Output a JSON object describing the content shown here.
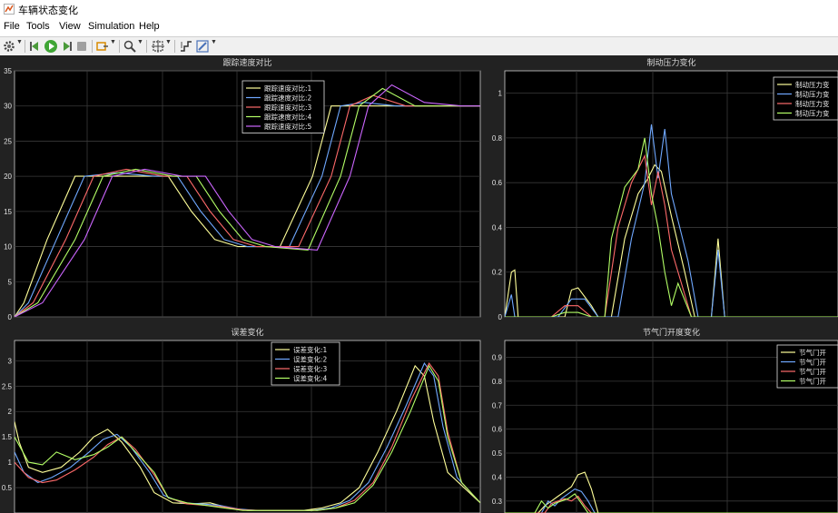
{
  "window": {
    "title": "车辆状态变化"
  },
  "menu": [
    "File",
    "Tools",
    "View",
    "Simulation",
    "Help"
  ],
  "toolbar": {
    "icons": [
      "settings-icon",
      "step-back-icon",
      "run-icon",
      "step-forward-icon",
      "stop-icon",
      "highlight-icon",
      "zoom-icon",
      "fit-icon",
      "cursor-measure-icon",
      "style-icon"
    ]
  },
  "colors": {
    "plot_bg": "#000000",
    "figure_bg": "#222222",
    "grid": "#3a3a3a",
    "axis_text": "#e0e0e0"
  },
  "chart_data": [
    {
      "type": "line",
      "title": "跟踪速度对比",
      "ylim": [
        0,
        35
      ],
      "yticks": [
        "0",
        "5",
        "10",
        "15",
        "20",
        "25",
        "30",
        "35"
      ],
      "xticks": [],
      "legend_position": "top-center",
      "series": [
        {
          "name": "跟踪速度对比:1",
          "color": "#ffff99",
          "x": [
            0,
            2,
            7,
            13,
            20,
            28,
            33,
            38,
            43,
            48,
            57,
            64,
            68,
            73,
            80,
            90,
            100
          ],
          "y": [
            0,
            2,
            11,
            20,
            20,
            20,
            20,
            15,
            11,
            10,
            10,
            20,
            30,
            30,
            30,
            30,
            30
          ]
        },
        {
          "name": "跟踪速度对比:2",
          "color": "#6fa8ff",
          "x": [
            0,
            3,
            9,
            15,
            22,
            30,
            35,
            40,
            45,
            50,
            59,
            66,
            70,
            75,
            82,
            90,
            100
          ],
          "y": [
            0,
            2,
            11,
            20,
            20.5,
            20,
            20,
            15,
            11,
            10,
            10,
            20,
            30,
            30.5,
            30,
            30,
            30
          ]
        },
        {
          "name": "跟踪速度对比:3",
          "color": "#ff6a6a",
          "x": [
            0,
            4,
            11,
            17,
            24,
            32,
            37,
            42,
            47,
            52,
            61,
            68,
            72,
            77,
            84,
            92,
            100
          ],
          "y": [
            0,
            2,
            11,
            20,
            21,
            20,
            20,
            15,
            11,
            10,
            10,
            20,
            30,
            31.5,
            30,
            30,
            30
          ]
        },
        {
          "name": "跟踪速度对比:4",
          "color": "#b3ff66",
          "x": [
            0,
            5,
            13,
            19,
            26,
            34,
            39,
            44,
            49,
            54,
            63,
            70,
            74,
            79,
            86,
            94,
            100
          ],
          "y": [
            0,
            2,
            11,
            20,
            21,
            20,
            20,
            15,
            11,
            10,
            9.5,
            20,
            30,
            32.5,
            30,
            30,
            30
          ]
        },
        {
          "name": "跟踪速度对比:5",
          "color": "#cc66ff",
          "x": [
            0,
            6,
            15,
            21,
            28,
            36,
            41,
            46,
            51,
            56,
            65,
            72,
            76,
            81,
            88,
            96,
            100
          ],
          "y": [
            0,
            2,
            11,
            20,
            21,
            20,
            20,
            15,
            11,
            10,
            9.5,
            20,
            30,
            33,
            30.5,
            30,
            30
          ]
        }
      ]
    },
    {
      "type": "line",
      "title": "制动压力变化",
      "ylim": [
        0,
        1.1
      ],
      "yticks": [
        "0",
        "0.2",
        "0.4",
        "0.6",
        "0.8",
        "1"
      ],
      "xticks": [],
      "legend_position": "top-right",
      "series": [
        {
          "name": "制动压力变",
          "color": "#ffff99",
          "x": [
            0,
            2,
            3,
            4,
            18,
            20,
            22,
            26,
            28,
            32,
            36,
            40,
            43,
            45,
            47,
            50,
            54,
            57,
            62,
            64,
            66,
            70,
            72,
            74,
            100
          ],
          "y": [
            0,
            0.2,
            0.21,
            0,
            0,
            0.12,
            0.13,
            0.05,
            0,
            0,
            0.35,
            0.55,
            0.62,
            0.68,
            0.65,
            0.45,
            0.2,
            0,
            0,
            0.35,
            0,
            0,
            0,
            0,
            0
          ]
        },
        {
          "name": "制动压力变",
          "color": "#6fa8ff",
          "x": [
            0,
            2,
            3,
            16,
            20,
            24,
            28,
            34,
            38,
            42,
            44,
            46,
            48,
            50,
            55,
            58,
            62,
            64,
            66,
            70,
            100
          ],
          "y": [
            0,
            0.1,
            0,
            0,
            0.08,
            0.08,
            0,
            0,
            0.35,
            0.6,
            0.86,
            0.62,
            0.84,
            0.55,
            0.25,
            0,
            0,
            0.3,
            0,
            0,
            0
          ]
        },
        {
          "name": "制动压力变",
          "color": "#ff6a6a",
          "x": [
            0,
            14,
            18,
            22,
            26,
            30,
            34,
            38,
            42,
            44,
            46,
            48,
            50,
            53,
            56,
            60,
            100
          ],
          "y": [
            0,
            0,
            0.05,
            0.05,
            0,
            0,
            0.4,
            0.6,
            0.72,
            0.5,
            0.65,
            0.5,
            0.3,
            0.15,
            0,
            0,
            0
          ]
        },
        {
          "name": "制动压力变",
          "color": "#b3ff66",
          "x": [
            0,
            14,
            18,
            22,
            26,
            30,
            32,
            36,
            40,
            42,
            44,
            46,
            48,
            50,
            52,
            56,
            100
          ],
          "y": [
            0,
            0,
            0.02,
            0.02,
            0,
            0,
            0.35,
            0.58,
            0.66,
            0.8,
            0.55,
            0.4,
            0.2,
            0.05,
            0.15,
            0,
            0
          ]
        }
      ]
    },
    {
      "type": "line",
      "title": "误差变化",
      "ylim": [
        0,
        3.4
      ],
      "yticks": [
        "0.5",
        "1",
        "1.5",
        "2",
        "2.5",
        "3"
      ],
      "xticks": [],
      "legend_position": "top-center",
      "series": [
        {
          "name": "误差变化:1",
          "color": "#ffff99",
          "x": [
            0,
            1,
            3,
            6,
            10,
            14,
            17,
            20,
            23,
            27,
            30,
            34,
            38,
            42,
            46,
            50,
            54,
            58,
            62,
            66,
            70,
            74,
            78,
            82,
            86,
            88,
            90,
            93,
            100
          ],
          "y": [
            1.8,
            1.4,
            0.9,
            0.8,
            0.9,
            1.2,
            1.5,
            1.65,
            1.4,
            0.9,
            0.4,
            0.2,
            0.18,
            0.2,
            0.1,
            0.05,
            0.05,
            0.05,
            0.05,
            0.1,
            0.2,
            0.5,
            1.2,
            2.0,
            2.9,
            2.7,
            1.8,
            0.8,
            0.2
          ]
        },
        {
          "name": "误差变化:2",
          "color": "#6fa8ff",
          "x": [
            0,
            2,
            5,
            8,
            12,
            16,
            19,
            22,
            25,
            29,
            32,
            36,
            40,
            44,
            48,
            52,
            56,
            60,
            64,
            68,
            72,
            76,
            80,
            84,
            88,
            90,
            92,
            95,
            100
          ],
          "y": [
            1.2,
            0.8,
            0.6,
            0.7,
            0.9,
            1.2,
            1.45,
            1.55,
            1.3,
            0.8,
            0.35,
            0.2,
            0.18,
            0.15,
            0.08,
            0.05,
            0.05,
            0.05,
            0.05,
            0.1,
            0.25,
            0.6,
            1.3,
            2.1,
            2.95,
            2.7,
            1.7,
            0.7,
            0.2
          ]
        },
        {
          "name": "误差变化:3",
          "color": "#ff6a6a",
          "x": [
            0,
            3,
            6,
            9,
            13,
            17,
            20,
            23,
            26,
            30,
            33,
            37,
            41,
            45,
            49,
            53,
            57,
            61,
            65,
            69,
            73,
            77,
            81,
            85,
            89,
            91,
            93,
            96,
            100
          ],
          "y": [
            1.0,
            0.7,
            0.6,
            0.65,
            0.85,
            1.1,
            1.35,
            1.5,
            1.25,
            0.75,
            0.3,
            0.18,
            0.15,
            0.12,
            0.06,
            0.05,
            0.05,
            0.05,
            0.05,
            0.1,
            0.25,
            0.6,
            1.3,
            2.2,
            2.95,
            2.7,
            1.6,
            0.6,
            0.2
          ]
        },
        {
          "name": "误差变化:4",
          "color": "#b3ff66",
          "x": [
            0,
            3,
            6,
            9,
            13,
            17,
            20,
            23,
            26,
            30,
            33,
            37,
            41,
            45,
            49,
            53,
            57,
            61,
            65,
            69,
            73,
            77,
            81,
            85,
            89,
            91,
            93,
            96,
            100
          ],
          "y": [
            1.5,
            1.0,
            0.95,
            1.2,
            1.05,
            1.15,
            1.3,
            1.5,
            1.2,
            0.8,
            0.3,
            0.2,
            0.15,
            0.1,
            0.05,
            0.05,
            0.05,
            0.05,
            0.05,
            0.1,
            0.2,
            0.55,
            1.2,
            2.0,
            2.9,
            2.6,
            1.5,
            0.6,
            0.2
          ]
        }
      ]
    },
    {
      "type": "line",
      "title": "节气门开度变化",
      "ylim": [
        0.25,
        0.97
      ],
      "yticks": [
        "0.3",
        "0.4",
        "0.5",
        "0.6",
        "0.7",
        "0.8",
        "0.9"
      ],
      "xticks": [],
      "legend_position": "top-right",
      "series": [
        {
          "name": "节气门开",
          "color": "#ffff99",
          "x": [
            0,
            10,
            12,
            14,
            16,
            18,
            20,
            22,
            24,
            26,
            28,
            100
          ],
          "y": [
            0.25,
            0.25,
            0.28,
            0.3,
            0.32,
            0.34,
            0.36,
            0.41,
            0.42,
            0.35,
            0.25,
            0.25
          ]
        },
        {
          "name": "节气门开",
          "color": "#6fa8ff",
          "x": [
            0,
            11,
            13,
            15,
            17,
            19,
            21,
            23,
            25,
            27,
            100
          ],
          "y": [
            0.25,
            0.25,
            0.3,
            0.28,
            0.31,
            0.33,
            0.35,
            0.34,
            0.3,
            0.25,
            0.25
          ]
        },
        {
          "name": "节气门开",
          "color": "#ff6a6a",
          "x": [
            0,
            12,
            14,
            16,
            18,
            20,
            22,
            24,
            26,
            100
          ],
          "y": [
            0.25,
            0.25,
            0.29,
            0.3,
            0.31,
            0.3,
            0.32,
            0.28,
            0.25,
            0.25
          ]
        },
        {
          "name": "节气门开",
          "color": "#b3ff66",
          "x": [
            0,
            9,
            11,
            13,
            15,
            17,
            19,
            21,
            23,
            25,
            100
          ],
          "y": [
            0.25,
            0.25,
            0.3,
            0.27,
            0.29,
            0.3,
            0.31,
            0.33,
            0.29,
            0.25,
            0.25
          ]
        }
      ]
    }
  ]
}
